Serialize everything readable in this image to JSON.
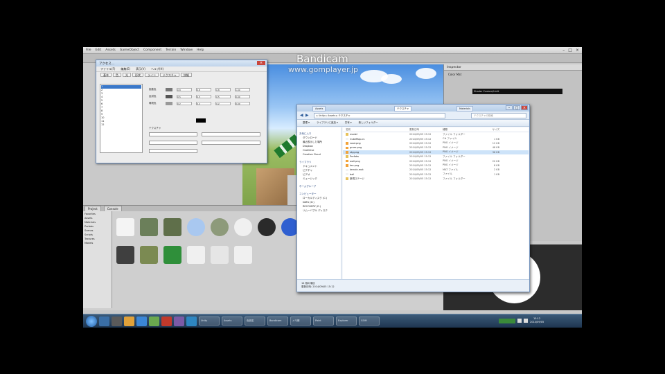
{
  "watermark": {
    "title": "Bandicam",
    "url": "www.gomplayer.jp"
  },
  "menubar": {
    "items": [
      "File",
      "Edit",
      "Assets",
      "GameObject",
      "Component",
      "Terrain",
      "Window",
      "Help"
    ]
  },
  "project": {
    "tabs": [
      "Project",
      "Console"
    ],
    "tree": [
      "Favorites",
      "Assets",
      "Materials",
      "Prefabs",
      "Scenes",
      "Scripts",
      "Textures",
      "Models"
    ],
    "assets": [
      {
        "label": "",
        "color": "#f4f4f4"
      },
      {
        "label": "",
        "color": "#6b7f5a"
      },
      {
        "label": "",
        "color": "#5f6f4a"
      },
      {
        "label": "",
        "color": "#a9c8f0"
      },
      {
        "label": "",
        "color": "#8d9a7a"
      },
      {
        "label": "",
        "color": "#f0f0f0"
      },
      {
        "label": "",
        "color": "#2a2a2a"
      },
      {
        "label": "",
        "color": "#2f5fd0"
      },
      {
        "label": "",
        "color": "#3f3f3f"
      },
      {
        "label": "",
        "color": "#7b8a52"
      },
      {
        "label": "",
        "color": "#2f8f3a"
      },
      {
        "label": "",
        "color": "#f0f0f0"
      },
      {
        "label": "",
        "color": "#e6e6e6"
      },
      {
        "label": "",
        "color": "#f0f0f0"
      }
    ]
  },
  "dialog": {
    "title": "アクセス...",
    "menu": [
      "ファイル(F)",
      "編集(E)",
      "表示(V)",
      "ヘルプ(H)"
    ],
    "tabs": [
      "基本",
      "色",
      "光",
      "形状",
      "ライン",
      "テクスチャ",
      "詳細"
    ],
    "list": [
      "1",
      "2",
      "3",
      "4",
      "5",
      "6",
      "7",
      "8",
      "9",
      "10",
      "11",
      "12"
    ],
    "labels": {
      "diffuse": "拡散色",
      "specular": "反射色",
      "ambient": "環境色",
      "tex": "テクスチャ",
      "ok": "OK"
    },
    "values": [
      "0.8",
      "0.8",
      "0.8",
      "1.00",
      "0.5",
      "0.5",
      "0.5",
      "0.00",
      "0.2",
      "0.2",
      "0.2",
      "0.00"
    ]
  },
  "explorer": {
    "tabs": [
      "Assets",
      "テクスチャ",
      "Materials"
    ],
    "address": "▸ Unity ▸ Assets ▸ テクスチャ",
    "search": "テクスチャの検索",
    "commands": [
      "整理 ▾",
      "ライブラリに追加 ▾",
      "共有 ▾",
      "新しいフォルダー"
    ],
    "nav": {
      "favorites": [
        "お気に入り",
        "ダウンロード",
        "最近表示した場所",
        "Dropbox",
        "OneDrive",
        "Creative Cloud"
      ],
      "libraries": [
        "ライブラリ",
        "ドキュメント",
        "ピクチャ",
        "ビデオ",
        "ミュージック"
      ],
      "homegroup": [
        "ホームグループ"
      ],
      "computer": [
        "コンピューター",
        "ローカルディスク (C:)",
        "DATA (D:)",
        "RECOVERY (E:)",
        "リムーバブル ディスク"
      ]
    },
    "headers": {
      "name": "名前",
      "date": "更新日時",
      "type": "種類",
      "size": "サイズ"
    },
    "files": [
      {
        "name": "model",
        "date": "2014/09/05 15:12",
        "type": "ファイル フォルダー",
        "size": "",
        "color": "#e8c25a"
      },
      {
        "name": "CubeMap.cs",
        "date": "2014/09/05 15:12",
        "type": "C# ファイル",
        "size": "1 KB",
        "color": "#f2f2f2"
      },
      {
        "name": "road.png",
        "date": "2014/09/05 15:12",
        "type": "PNG イメージ",
        "size": "12 KB",
        "color": "#f2a33a"
      },
      {
        "name": "grass.png",
        "date": "2014/09/05 15:12",
        "type": "PNG イメージ",
        "size": "48 KB",
        "color": "#f2a33a"
      },
      {
        "name": "sky.png",
        "date": "2014/09/05 15:12",
        "type": "PNG イメージ",
        "size": "36 KB",
        "color": "#f2a33a"
      },
      {
        "name": "Prefabs",
        "date": "2014/09/05 15:12",
        "type": "ファイル フォルダー",
        "size": "",
        "color": "#e8c25a"
      },
      {
        "name": "wall.png",
        "date": "2014/09/05 15:12",
        "type": "PNG イメージ",
        "size": "20 KB",
        "color": "#f2a33a"
      },
      {
        "name": "tex.png",
        "date": "2014/09/05 15:12",
        "type": "PNG イメージ",
        "size": "8 KB",
        "color": "#f2a33a"
      },
      {
        "name": "terrain.mat",
        "date": "2014/09/05 15:12",
        "type": "MAT ファイル",
        "size": "2 KB",
        "color": "#f2f2f2"
      },
      {
        "name": "ball",
        "date": "2014/09/05 15:12",
        "type": "ファイル",
        "size": "1 KB",
        "color": "#f2f2f2"
      },
      {
        "name": "新規ステージ",
        "date": "2014/09/05 15:12",
        "type": "ファイル フォルダー",
        "size": "",
        "color": "#e8c25a"
      }
    ],
    "status": {
      "line1": "14 個の項目",
      "line2": "更新日時: 2014/09/05 15:12"
    }
  },
  "inspector": {
    "title": "Inspector",
    "header": "Color Mat",
    "dark": "Shader  Custom/Unlit"
  },
  "taskbar": {
    "apps": [
      {
        "color": "#3a6ea5"
      },
      {
        "color": "#5a5a5a"
      },
      {
        "color": "#e0a13a"
      },
      {
        "color": "#3b86d6"
      },
      {
        "color": "#6aa84f"
      },
      {
        "color": "#c0392b"
      },
      {
        "color": "#7b5aa6"
      },
      {
        "color": "#2e86c1"
      }
    ],
    "buttons": [
      "Unity",
      "Assets",
      "色設定",
      "Bandicam",
      "メモ帳",
      "Paint",
      "Explorer",
      "GOM"
    ],
    "clock": {
      "time": "15:12",
      "date": "2014/09/05"
    }
  }
}
